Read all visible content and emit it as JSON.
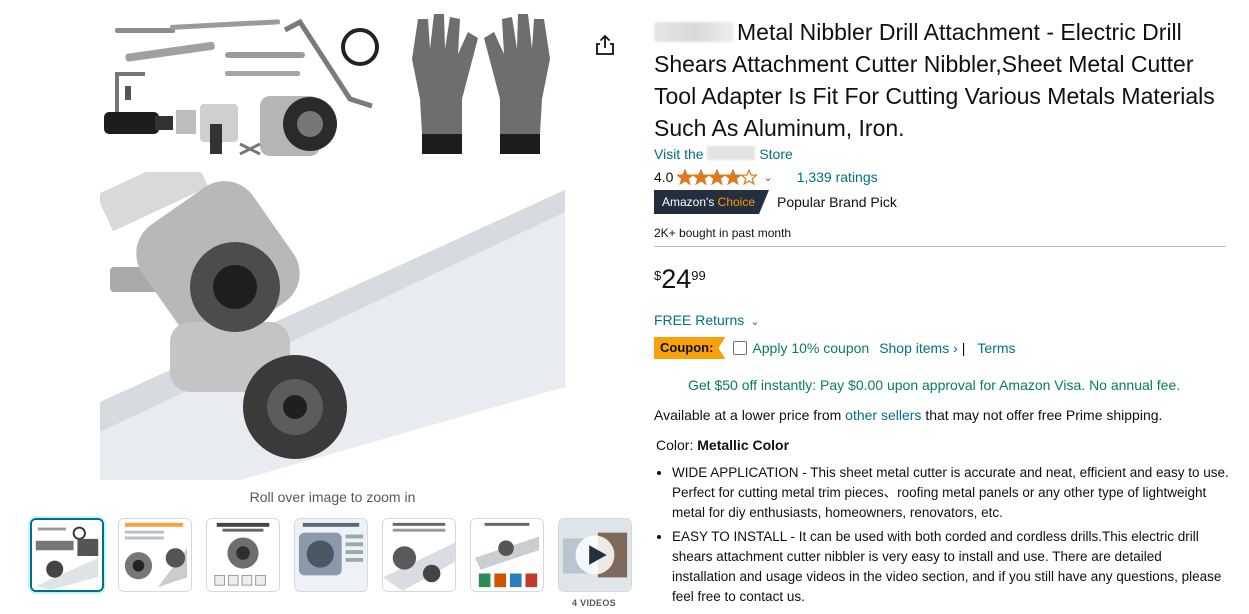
{
  "media": {
    "zoom_hint": "Roll over image to zoom in",
    "videos_label": "4 VIDEOS",
    "thumbnail_count": 7,
    "selected_thumbnail": 1
  },
  "product": {
    "title": "Metal Nibbler Drill Attachment - Electric Drill Shears Attachment Cutter Nibbler,Sheet Metal Cutter Tool Adapter Is Fit For Cutting Various Metals Materials Such As Aluminum, Iron.",
    "store_prefix": "Visit the",
    "store_suffix": "Store",
    "rating_value": "4.0",
    "rating_stars": 4,
    "ratings_count": "1,339 ratings",
    "badge_prefix": "Amazon's",
    "badge_suffix": "Choice",
    "badge_text": "Popular Brand Pick",
    "bought": "2K+ bought in past month",
    "price_symbol": "$",
    "price_whole": "24",
    "price_fraction": "99",
    "returns": "FREE Returns",
    "coupon_label": "Coupon:",
    "coupon_apply": "Apply 10% coupon",
    "coupon_shop": "Shop items ›",
    "coupon_sep": "|",
    "coupon_terms": "Terms",
    "visa_offer": "Get $50 off instantly: Pay $0.00 upon approval for Amazon Visa. No annual fee.",
    "lower_price_pre": "Available at a lower price from",
    "lower_price_link": "other sellers",
    "lower_price_post": "that may not offer free Prime shipping.",
    "color_label": "Color:",
    "color_value": "Metallic Color",
    "bullets": [
      "WIDE APPLICATION - This sheet metal cutter is accurate and neat, efficient and easy to use. Perfect for cutting metal trim pieces、roofing metal panels or any other type of lightweight metal for diy enthusiasts, homeowners, renovators, etc.",
      "EASY TO INSTALL - It can be used with both corded and cordless drills.This electric drill shears attachment cutter nibbler is very easy to install and use. There are detailed installation and usage videos in the video section, and if you still have any questions, please feel free to contact us."
    ]
  },
  "colors": {
    "link": "#007185",
    "green_link": "#067d62",
    "star": "#de7921",
    "badge_dark": "#232f3e",
    "coupon_orange": "#f7a10c"
  }
}
